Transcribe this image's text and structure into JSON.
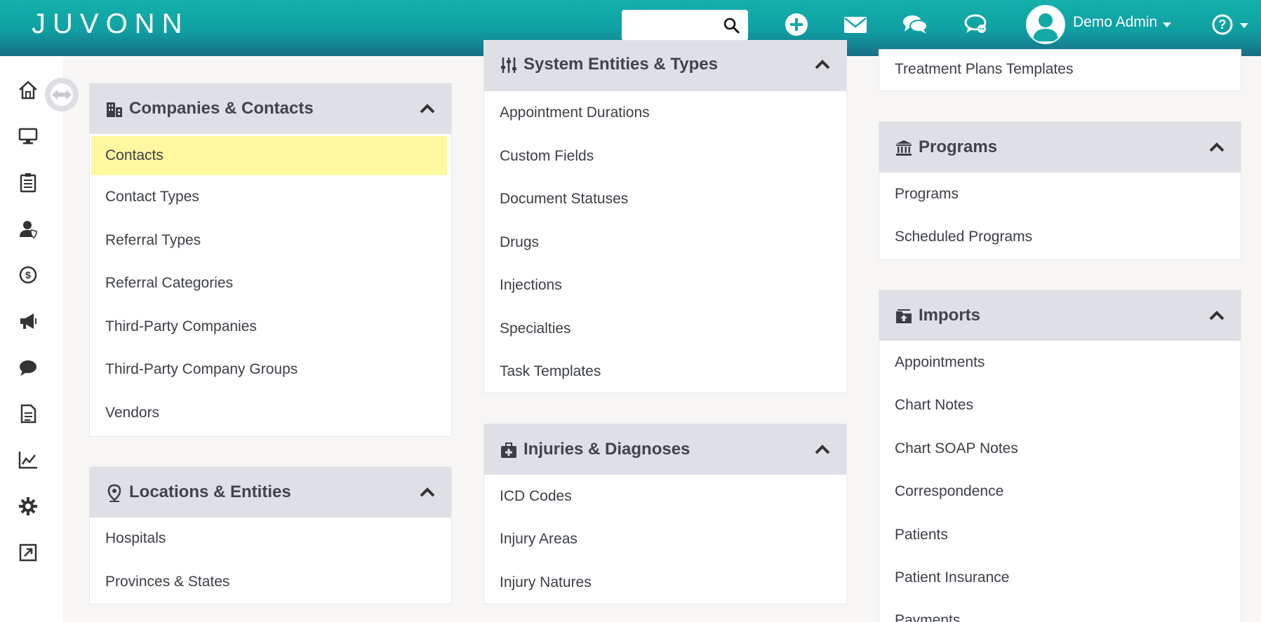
{
  "header": {
    "logo_text": "JUVONNO",
    "search": {
      "value": "",
      "placeholder": ""
    },
    "icons": [
      "add-circle-icon",
      "envelope-icon",
      "comments-icon",
      "chat-dots-icon"
    ],
    "user": {
      "name": "Demo Admin"
    },
    "help_icon": "question-circle-icon",
    "colors": {
      "gradient_top": "#13b1aa",
      "gradient_bottom": "#1a6e86"
    }
  },
  "sidebar": {
    "icons": [
      "home-icon",
      "desktop-icon",
      "clipboard-icon",
      "user-shield-icon",
      "dollar-circle-icon",
      "megaphone-icon",
      "chat-bubble-icon",
      "document-icon",
      "chart-line-icon",
      "gear-icon",
      "external-link-icon"
    ]
  },
  "cards": {
    "companies": {
      "title": "Companies & Contacts",
      "items": [
        "Contacts",
        "Contact Types",
        "Referral Types",
        "Referral Categories",
        "Third-Party Companies",
        "Third-Party Company Groups",
        "Vendors"
      ]
    },
    "locations": {
      "title": "Locations & Entities",
      "items": [
        "Hospitals",
        "Provinces & States"
      ]
    },
    "system": {
      "title": "System Entities & Types",
      "items": [
        "Appointment Durations",
        "Custom Fields",
        "Document Statuses",
        "Drugs",
        "Injections",
        "Specialties",
        "Task Templates"
      ]
    },
    "injuries": {
      "title": "Injuries & Diagnoses",
      "items": [
        "ICD Codes",
        "Injury Areas",
        "Injury Natures"
      ]
    },
    "treatment": {
      "items": [
        "Treatment Plans Templates"
      ]
    },
    "programs": {
      "title": "Programs",
      "items": [
        "Programs",
        "Scheduled Programs"
      ]
    },
    "imports": {
      "title": "Imports",
      "items": [
        "Appointments",
        "Chart Notes",
        "Chart SOAP Notes",
        "Correspondence",
        "Patients",
        "Patient Insurance",
        "Payments"
      ]
    }
  },
  "highlight_color": "#fff8a0"
}
